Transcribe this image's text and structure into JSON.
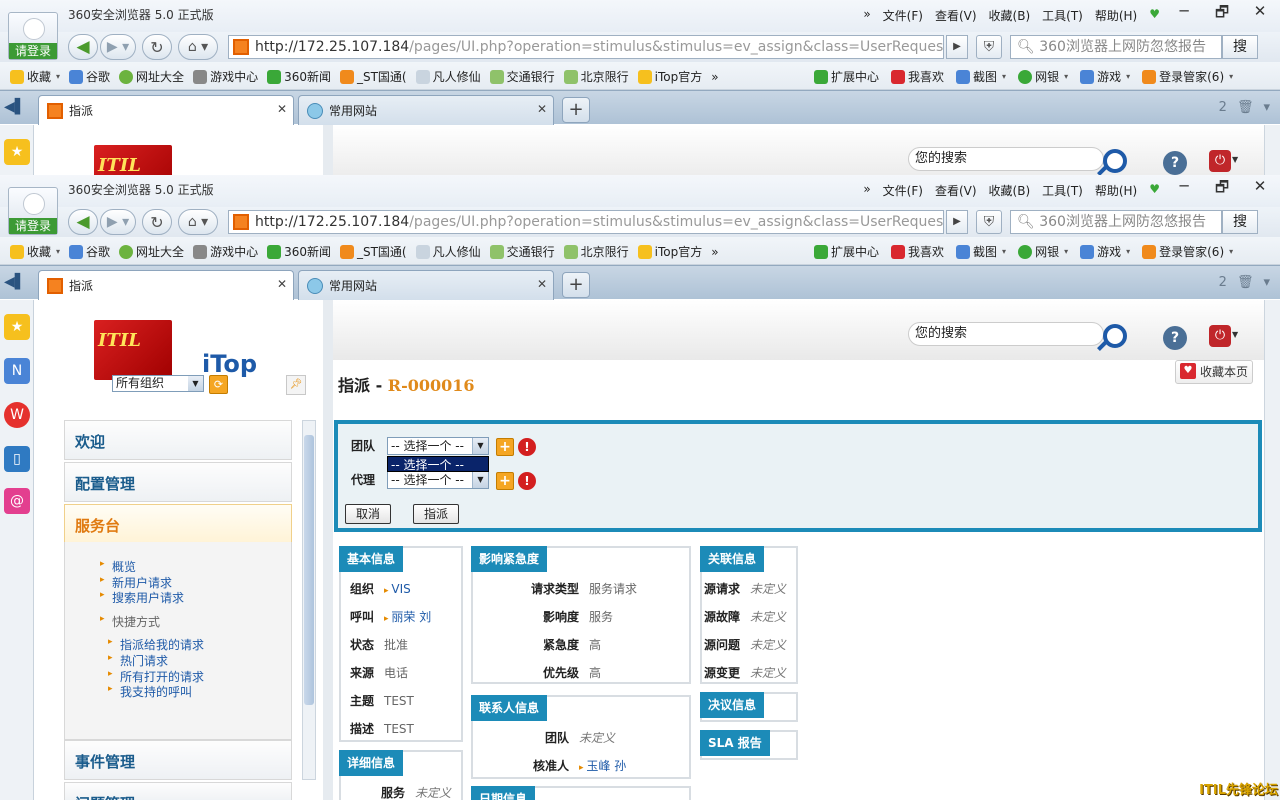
{
  "browser": {
    "title": "360安全浏览器 5.0 正式版",
    "login_label": "请登录",
    "menu": [
      "文件(F)",
      "查看(V)",
      "收藏(B)",
      "工具(T)",
      "帮助(H)"
    ],
    "menu_arrow": "»",
    "window_controls": {
      "minimize": "─",
      "restore": "🗗",
      "close": "✕"
    },
    "url": {
      "host": "http://172.25.107.184",
      "path": "/pages/UI.php?operation=stimulus&stimulus=ev_assign&class=UserRequest&id="
    },
    "search_placeholder": "360浏览器上网防忽悠报告",
    "search_button": "搜",
    "favorites_left": [
      "收藏",
      "谷歌",
      "网址大全",
      "游戏中心",
      "360新闻",
      "_ST国通(",
      "凡人修仙",
      "交通银行",
      "北京限行",
      "iTop官方"
    ],
    "favorites_more": "»",
    "favorites_right": [
      "扩展中心",
      "我喜欢",
      "截图",
      "网银",
      "游戏",
      "登录管家(6)"
    ],
    "tabs": [
      {
        "label": "指派",
        "close": "✕"
      },
      {
        "label": "常用网站",
        "close": "✕"
      }
    ],
    "new_tab": "+",
    "tab_count": "2"
  },
  "colors": {
    "accent": "#1c8bb8",
    "brand_orange": "#e08a1b",
    "link": "#1e5aa8",
    "error": "#d31f1f"
  },
  "sidebar": {
    "logo_text": "iTop",
    "logo_flag": "ITIL",
    "org_select": "所有组织",
    "menu": [
      {
        "label": "欢迎"
      },
      {
        "label": "配置管理"
      },
      {
        "label": "服务台"
      },
      {
        "label": "事件管理"
      },
      {
        "label": "问题管理"
      }
    ],
    "helpdesk_links": [
      "概览",
      "新用户请求",
      "搜索用户请求"
    ],
    "shortcuts_label": "快捷方式",
    "shortcuts": [
      "指派给我的请求",
      "热门请求",
      "所有打开的请求",
      "我支持的呼叫"
    ]
  },
  "header": {
    "search_placeholder": "您的搜索",
    "help": "?",
    "favorite_page": "收藏本页"
  },
  "page": {
    "title": "指派",
    "ref": "R-000016"
  },
  "assign_form": {
    "team_label": "团队",
    "team_value": "-- 选择一个 --",
    "team_dropdown_option": "-- 选择一个 --",
    "agent_label": "代理",
    "agent_value": "-- 选择一个 --",
    "cancel": "取消",
    "assign": "指派"
  },
  "sections": {
    "basic": {
      "title": "基本信息",
      "rows": [
        {
          "label": "组织",
          "value": "VIS"
        },
        {
          "label": "呼叫",
          "value": "丽荣 刘"
        },
        {
          "label": "状态",
          "value": "批准"
        },
        {
          "label": "来源",
          "value": "电话"
        },
        {
          "label": "主题",
          "value": "TEST"
        },
        {
          "label": "描述",
          "value": "TEST"
        }
      ]
    },
    "detail": {
      "title": "详细信息",
      "rows": [
        {
          "label": "服务",
          "value": "未定义"
        }
      ]
    },
    "impact": {
      "title": "影响紧急度",
      "rows": [
        {
          "label": "请求类型",
          "value": "服务请求"
        },
        {
          "label": "影响度",
          "value": "服务"
        },
        {
          "label": "紧急度",
          "value": "高"
        },
        {
          "label": "优先级",
          "value": "高"
        }
      ]
    },
    "contacts": {
      "title": "联系人信息",
      "rows": [
        {
          "label": "团队",
          "value": "未定义"
        },
        {
          "label": "核准人",
          "value": "玉峰 孙"
        }
      ]
    },
    "dates": {
      "title": "日期信息"
    },
    "related": {
      "title": "关联信息",
      "rows": [
        {
          "label": "源请求",
          "value": "未定义"
        },
        {
          "label": "源故障",
          "value": "未定义"
        },
        {
          "label": "源问题",
          "value": "未定义"
        },
        {
          "label": "源变更",
          "value": "未定义"
        }
      ]
    },
    "resolution": {
      "title": "决议信息"
    },
    "sla": {
      "title": "SLA 报告"
    }
  },
  "watermark": "ITIL先锋论坛"
}
